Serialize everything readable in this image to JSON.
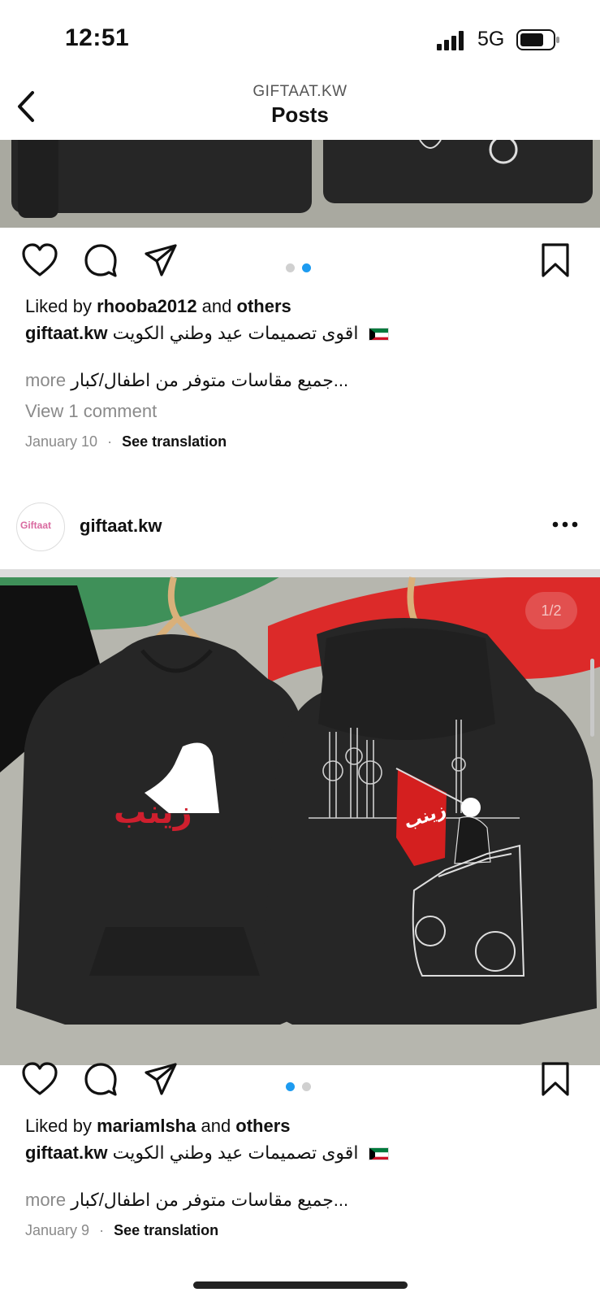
{
  "status_bar": {
    "time": "12:51",
    "network": "5G"
  },
  "nav": {
    "subtitle": "GIFTAAT.KW",
    "title": "Posts"
  },
  "post1": {
    "liked_prefix": "Liked by ",
    "liked_user": "rhooba2012",
    "liked_and": " and ",
    "liked_others": "others",
    "caption_user": "giftaat.kw",
    "caption_text": "اقوى تصميمات عيد وطني الكويت",
    "caption_more_text": "جميع مقاسات متوفر من اطفال/كبار...",
    "more_label": "more",
    "view_comments": "View 1 comment",
    "date": "January 10",
    "separator": "·",
    "see_translation": "See translation",
    "carousel_count": 2,
    "carousel_active": 2
  },
  "post2": {
    "username": "giftaat.kw",
    "avatar_text": "Giftaat",
    "image_counter": "1/2",
    "hoodie_front_name": "زينب",
    "hoodie_back_flag_text": "زينب",
    "liked_prefix": "Liked by ",
    "liked_user": "mariamlsha",
    "liked_and": " and ",
    "liked_others": "others",
    "caption_user": "giftaat.kw",
    "caption_text": "اقوى تصميمات عيد وطني الكويت",
    "caption_more_text": "جميع مقاسات متوفر من اطفال/كبار...",
    "more_label": "more",
    "date": "January 9",
    "separator": "·",
    "see_translation": "See translation",
    "carousel_count": 2,
    "carousel_active": 1
  },
  "icons": [
    "back-icon",
    "heart-icon",
    "comment-icon",
    "share-icon",
    "bookmark-icon",
    "more-icon",
    "signal-icon",
    "battery-icon",
    "kuwait-flag-icon"
  ],
  "colors": {
    "accent": "#1d9bf0",
    "flag_green": "#007a3d",
    "flag_red": "#ce1126",
    "hoodie": "#262626"
  }
}
